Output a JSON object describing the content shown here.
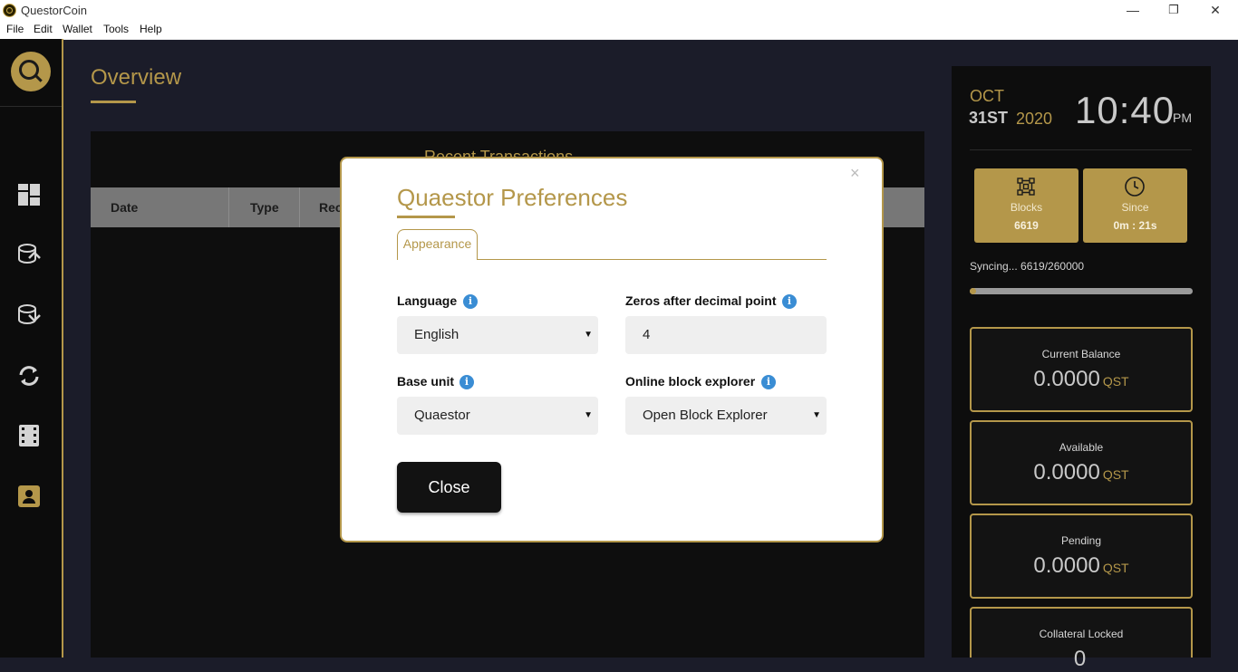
{
  "window": {
    "title": "QuestorCoin",
    "minimize": "—",
    "restore": "❐",
    "close": "✕"
  },
  "menu": [
    "File",
    "Edit",
    "Wallet",
    "Tools",
    "Help"
  ],
  "sidebar": {
    "icons": [
      "dashboard-icon",
      "send-coins-icon",
      "receive-coins-icon",
      "sync-icon",
      "transactions-icon",
      "contacts-icon"
    ]
  },
  "overview": {
    "title": "Overview",
    "transactions_title": "Recent Transactions",
    "columns": [
      "Date",
      "Type",
      "Rec"
    ]
  },
  "clock": {
    "month": "OCT",
    "day": "31ST",
    "year": "2020",
    "time": "10:40",
    "ampm": "PM"
  },
  "stats": {
    "blocks_label": "Blocks",
    "blocks_value": "6619",
    "since_label": "Since",
    "since_value": "0m : 21s"
  },
  "sync": {
    "text": "Syncing...  6619/260000",
    "progress": 0.0255
  },
  "balances": [
    {
      "label": "Current Balance",
      "amount": "0.0000",
      "unit": "QST"
    },
    {
      "label": "Available",
      "amount": "0.0000",
      "unit": "QST"
    },
    {
      "label": "Pending",
      "amount": "0.0000",
      "unit": "QST"
    },
    {
      "label": "Collateral Locked",
      "amount": "0",
      "unit": ""
    }
  ],
  "modal": {
    "title": "Quaestor Preferences",
    "close_x": "×",
    "tab": "Appearance",
    "language_label": "Language",
    "language_value": "English",
    "zeros_label": "Zeros after decimal point",
    "zeros_value": "4",
    "base_unit_label": "Base unit",
    "base_unit_value": "Quaestor",
    "explorer_label": "Online block explorer",
    "explorer_value": "Open Block Explorer",
    "info_glyph": "i",
    "close_button": "Close"
  },
  "colors": {
    "accent": "#b4974a",
    "background": "#1b1c29",
    "sidebar": "#0c0c0c",
    "info": "#3a8dd4"
  }
}
